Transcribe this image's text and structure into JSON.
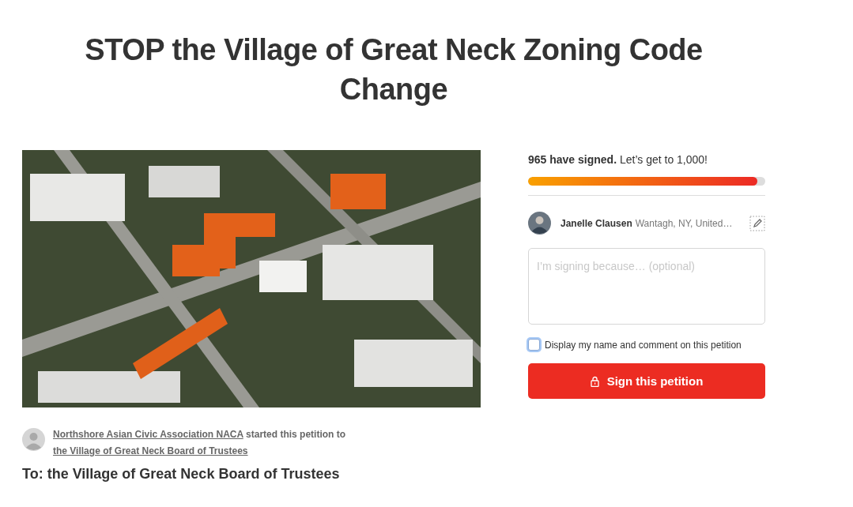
{
  "title": "STOP the Village of Great Neck Zoning Code Change",
  "starter": {
    "author": "Northshore Asian Civic Association NACA",
    "middle": "started this petition to",
    "target": "the Village of Great Neck Board of Trustees"
  },
  "to": "To: the Village of Great Neck Board of Trustees",
  "sign_panel": {
    "count": "965 have signed.",
    "goal": "Let’s get to 1,000!",
    "level": 0.965,
    "signer": {
      "name": "Janelle Clausen",
      "location": "Wantagh, NY, United…"
    },
    "comment": {
      "placeholder": "I’m signing because… (optional)"
    },
    "display_option": {
      "label": "Display my name and comment on this petition",
      "checked": false
    },
    "button": "Sign this petition"
  }
}
